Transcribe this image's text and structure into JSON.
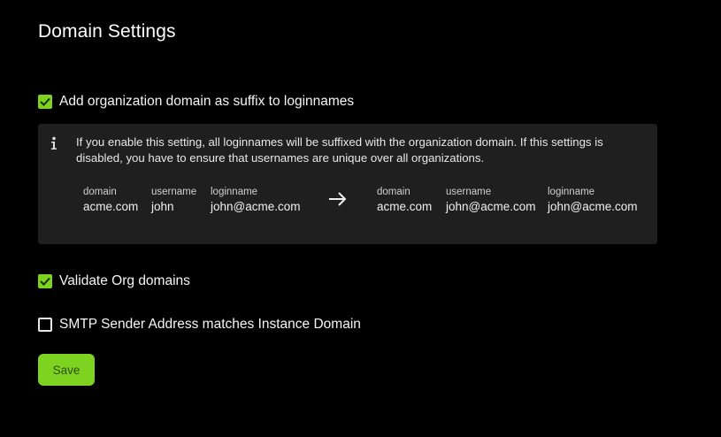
{
  "page": {
    "title": "Domain Settings"
  },
  "settings": {
    "suffix_loginnames": {
      "label": "Add organization domain as suffix to loginnames",
      "checked": true
    },
    "validate_org_domains": {
      "label": "Validate Org domains",
      "checked": true
    },
    "smtp_sender_matches_domain": {
      "label": "SMTP Sender Address matches Instance Domain",
      "checked": false
    }
  },
  "info": {
    "icon": "info-icon",
    "text": "If you enable this setting, all loginnames will be suffixed with the organization domain. If this settings is disabled, you have to ensure that usernames are unique over all organizations.",
    "before": {
      "domain_label": "domain",
      "domain_value": "acme.com",
      "username_label": "username",
      "username_value": "john",
      "loginname_label": "loginname",
      "loginname_value": "john@acme.com"
    },
    "arrow_icon": "arrow-right-icon",
    "after": {
      "domain_label": "domain",
      "domain_value": "acme.com",
      "username_label": "username",
      "username_value": "john@acme.com",
      "loginname_label": "loginname",
      "loginname_value": "john@acme.com"
    }
  },
  "actions": {
    "save_label": "Save"
  },
  "colors": {
    "accent": "#7ed321",
    "background": "#000000",
    "panel": "#1f1f1f"
  }
}
